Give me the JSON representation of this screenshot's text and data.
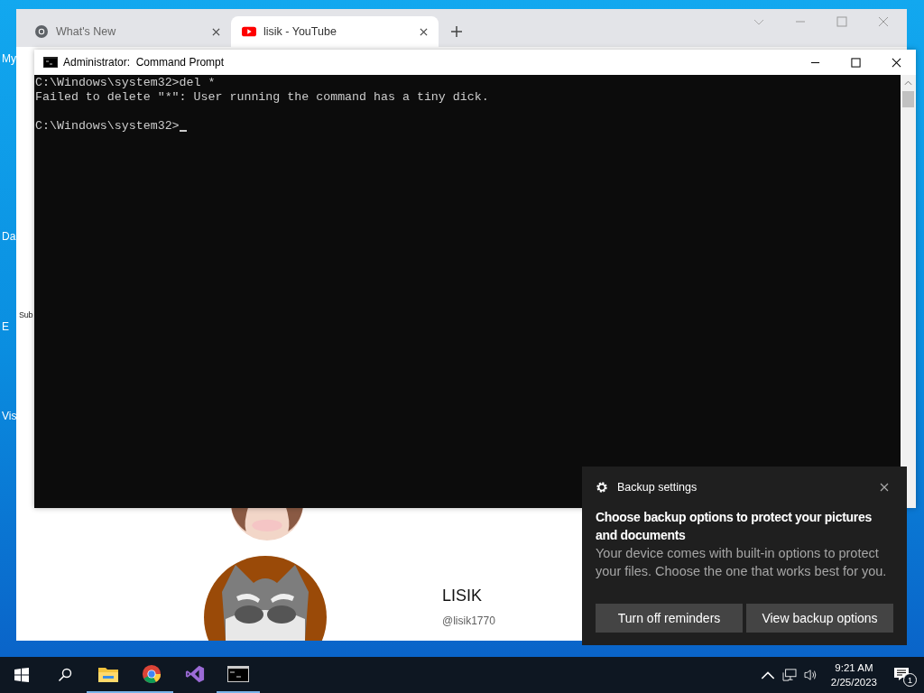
{
  "desktop": {
    "icon_labels": [
      "My",
      "Da",
      "E",
      "Vis"
    ]
  },
  "browser": {
    "tabs": [
      {
        "title": "What's New",
        "kind": "chrome",
        "selected": false
      },
      {
        "title": "lisik - YouTube",
        "kind": "youtube",
        "selected": true
      }
    ],
    "page": {
      "side_label": "Sub",
      "channel_name": "LISIK",
      "channel_handle": "@lisik1770"
    }
  },
  "console": {
    "title": "Administrator:  Command Prompt",
    "output_blocks": [
      [
        "C:\\Windows\\system32>del *",
        "Failed to delete \"*\": User running the command has a tiny dick."
      ],
      [
        "C:\\Windows\\system32>"
      ]
    ],
    "cursor": true
  },
  "toast": {
    "app": "Backup settings",
    "title": "Choose backup options to protect your pictures and documents",
    "body": "Your device comes with built-in options to protect your files. Choose the one that works best for you.",
    "buttons": [
      "Turn off reminders",
      "View backup options"
    ]
  },
  "taskbar": {
    "apps": [
      {
        "kind": "explorer",
        "running": true
      },
      {
        "kind": "chrome",
        "running": true
      },
      {
        "kind": "studio",
        "running": false
      },
      {
        "kind": "console",
        "running": true
      }
    ],
    "time": "9:21 AM",
    "date": "2/25/2023",
    "notifications": "1"
  }
}
